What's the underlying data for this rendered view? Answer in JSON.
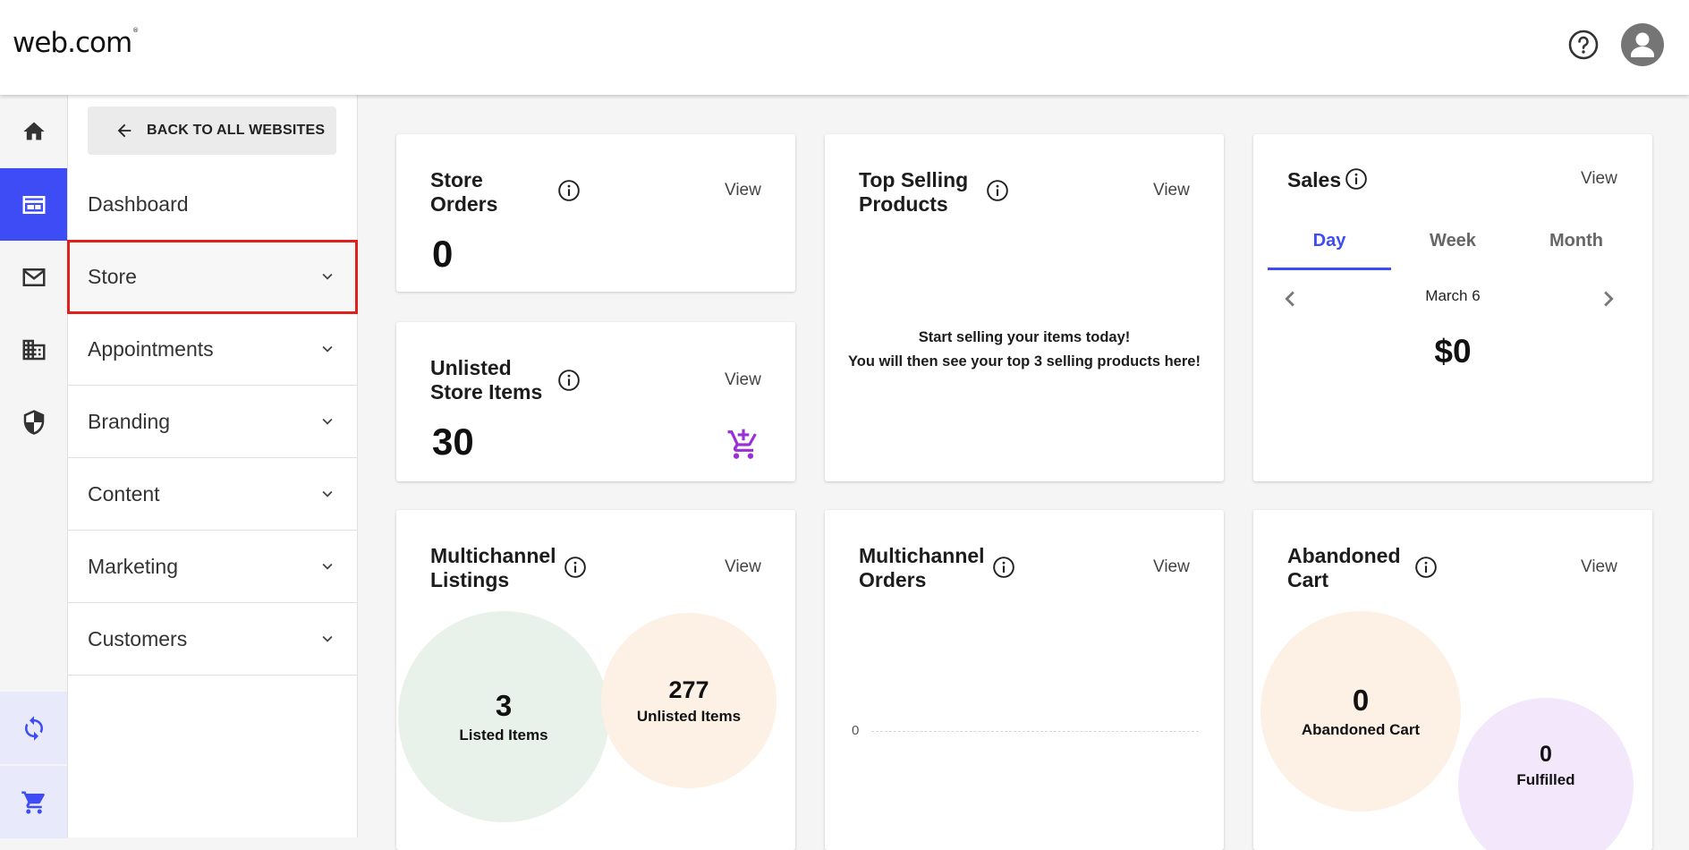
{
  "header": {
    "logo": "web.com",
    "logo_mark": "®",
    "help_icon": "help-circle-icon",
    "avatar_icon": "person-icon"
  },
  "rail": [
    {
      "icon": "home-icon"
    },
    {
      "icon": "website-icon",
      "active": true
    },
    {
      "icon": "mail-icon"
    },
    {
      "icon": "building-icon"
    },
    {
      "icon": "shield-icon"
    },
    {
      "icon": "sync-icon"
    },
    {
      "icon": "cart-icon"
    }
  ],
  "nav": {
    "back_label": "BACK TO ALL WEBSITES",
    "items": [
      {
        "label": "Dashboard"
      },
      {
        "label": "Store",
        "highlighted": true
      },
      {
        "label": "Appointments"
      },
      {
        "label": "Branding"
      },
      {
        "label": "Content"
      },
      {
        "label": "Marketing"
      },
      {
        "label": "Customers"
      }
    ]
  },
  "cards": {
    "store_orders": {
      "title_line1": "Store",
      "title_line2": "Orders",
      "view": "View",
      "value": "0"
    },
    "unlisted": {
      "title_line1": "Unlisted",
      "title_line2": "Store Items",
      "view": "View",
      "value": "30"
    },
    "top_selling": {
      "title_line1": "Top Selling",
      "title_line2": "Products",
      "view": "View",
      "message_line1": "Start selling your items today!",
      "message_line2": "You will then see your top 3 selling products here!"
    },
    "sales": {
      "title": "Sales",
      "view": "View",
      "tabs": [
        "Day",
        "Week",
        "Month"
      ],
      "active_tab": "Day",
      "date": "March 6",
      "value": "$0"
    },
    "multi_listings": {
      "title_line1": "Multichannel",
      "title_line2": "Listings",
      "view": "View",
      "listed_value": "3",
      "listed_label": "Listed Items",
      "unlisted_value": "277",
      "unlisted_label": "Unlisted Items"
    },
    "multi_orders": {
      "title_line1": "Multichannel",
      "title_line2": "Orders",
      "view": "View",
      "axis_zero": "0"
    },
    "abandoned": {
      "title_line1": "Abandoned",
      "title_line2": "Cart",
      "view": "View",
      "abandoned_value": "0",
      "abandoned_label": "Abandoned Cart",
      "fulfilled_value": "0",
      "fulfilled_label": "Fulfilled"
    }
  },
  "colors": {
    "accent": "#3d4cf5",
    "highlight_border": "#e0201c",
    "cart_icon": "#9b2fd6",
    "listed_bubble": "#e8f2ea",
    "unlisted_bubble": "#fdf0e4",
    "fulfilled_bubble": "#f3e7fb"
  }
}
